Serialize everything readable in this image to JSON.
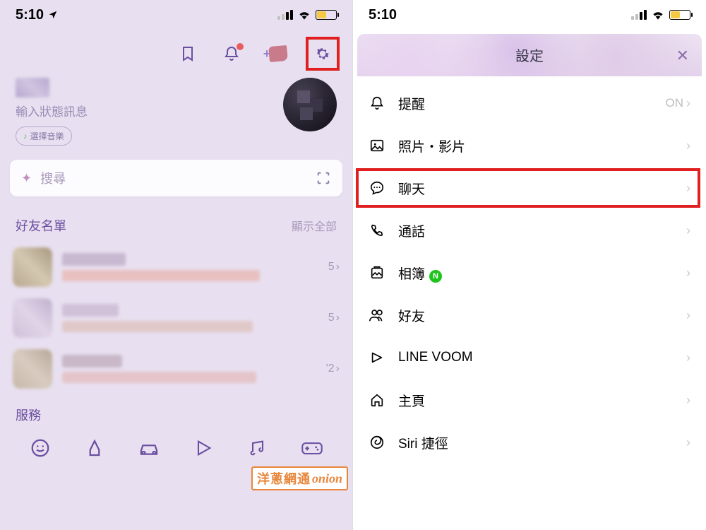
{
  "status": {
    "time": "5:10"
  },
  "left": {
    "status_placeholder": "輸入狀態訊息",
    "music_chip": "選擇音樂",
    "search_placeholder": "搜尋",
    "friends_title": "好友名單",
    "friends_showall": "顯示全部",
    "friends": [
      {
        "count": "5"
      },
      {
        "count": "5"
      },
      {
        "count": "'2"
      }
    ],
    "service_title": "服務"
  },
  "right": {
    "header_title": "設定",
    "items": [
      {
        "icon": "bell",
        "label": "提醒",
        "value": "ON"
      },
      {
        "icon": "photo",
        "label": "照片・影片"
      },
      {
        "icon": "chat",
        "label": "聊天",
        "highlight": true
      },
      {
        "icon": "phone",
        "label": "通話"
      },
      {
        "icon": "album",
        "label": "相簿",
        "badge": "N"
      },
      {
        "icon": "friends",
        "label": "好友"
      },
      {
        "icon": "voom",
        "label": "LINE VOOM"
      },
      {
        "icon": "home",
        "label": "主頁"
      },
      {
        "icon": "siri",
        "label": "Siri 捷徑"
      }
    ]
  },
  "watermark": {
    "cn": "洋蔥網通",
    "en": "onion"
  }
}
